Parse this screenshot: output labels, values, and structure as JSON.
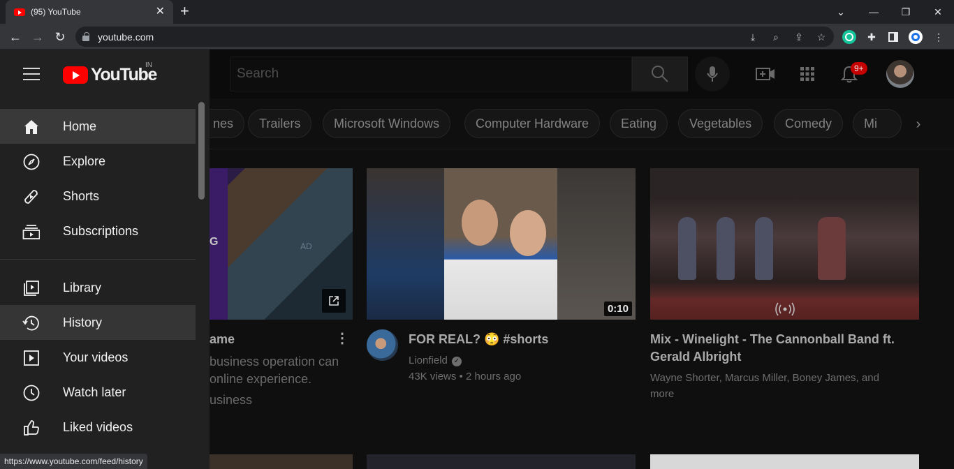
{
  "browser": {
    "tab_title": "(95) YouTube",
    "url": "youtube.com",
    "status_url": "https://www.youtube.com/feed/history"
  },
  "header": {
    "logo_text": "YouTube",
    "country_code": "IN",
    "search_placeholder": "Search",
    "notification_count": "9+"
  },
  "sidebar": {
    "items": [
      {
        "label": "Home",
        "icon": "home-icon"
      },
      {
        "label": "Explore",
        "icon": "compass-icon"
      },
      {
        "label": "Shorts",
        "icon": "shorts-icon"
      },
      {
        "label": "Subscriptions",
        "icon": "subscriptions-icon"
      },
      {
        "label": "Library",
        "icon": "library-icon"
      },
      {
        "label": "History",
        "icon": "history-icon"
      },
      {
        "label": "Your videos",
        "icon": "your-videos-icon"
      },
      {
        "label": "Watch later",
        "icon": "clock-icon"
      },
      {
        "label": "Liked videos",
        "icon": "thumbs-up-icon"
      }
    ]
  },
  "chips": [
    "nes",
    "Trailers",
    "Microsoft Windows",
    "Computer Hardware",
    "Eating",
    "Vegetables",
    "Comedy",
    "Mi"
  ],
  "videos": [
    {
      "title": "ame",
      "desc_lines": [
        "business operation can",
        "online experience.",
        "usiness"
      ]
    },
    {
      "title": "FOR REAL? 😳 #shorts",
      "channel": "Lionfield",
      "views": "43K views",
      "age": "2 hours ago",
      "duration": "0:10"
    },
    {
      "title_line1": "Mix - Winelight - The Cannonball Band ft.",
      "title_line2": "Gerald Albright",
      "meta_line1": "Wayne Shorter, Marcus Miller, Boney James, and",
      "meta_line2": "more"
    }
  ],
  "thumb_text": {
    "g": "G",
    "ad": "AD"
  },
  "colors": {
    "brand_red": "#ff0000",
    "badge_red": "#c40000"
  }
}
